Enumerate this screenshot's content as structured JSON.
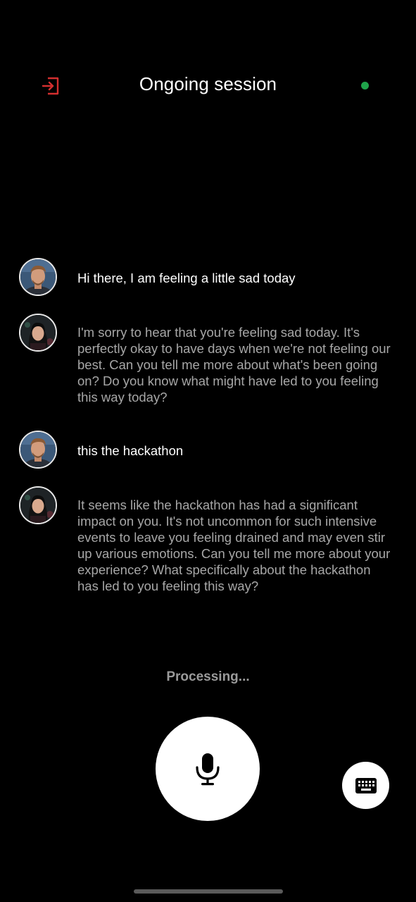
{
  "header": {
    "title": "Ongoing session",
    "exit_icon": "exit-session-icon",
    "status_icon": "connection-status-dot"
  },
  "colors": {
    "accent_exit": "#d32f2f",
    "status_online": "#1fa34a",
    "user_text": "#ffffff",
    "assistant_text": "#a7a7a7",
    "background": "#000000"
  },
  "messages": [
    {
      "role": "user",
      "avatar": "user-avatar",
      "text": "Hi there, I am feeling a little sad today"
    },
    {
      "role": "assistant",
      "avatar": "assistant-avatar",
      "text": "I'm sorry to hear that you're feeling sad today. It's perfectly okay to have days when we're not feeling our best. Can you tell me more about what's been going on? Do you know what might have led to you feeling this way today?"
    },
    {
      "role": "user",
      "avatar": "user-avatar",
      "text": "this the hackathon"
    },
    {
      "role": "assistant",
      "avatar": "assistant-avatar",
      "text": "It seems like the hackathon has had a significant impact on you. It's not uncommon for such intensive events to leave you feeling drained and may even stir up various emotions. Can you tell me more about your experience? What specifically about the hackathon has led to you feeling this way?"
    }
  ],
  "status": {
    "processing_text": "Processing..."
  },
  "controls": {
    "mic_icon": "microphone-icon",
    "keyboard_icon": "keyboard-icon"
  }
}
